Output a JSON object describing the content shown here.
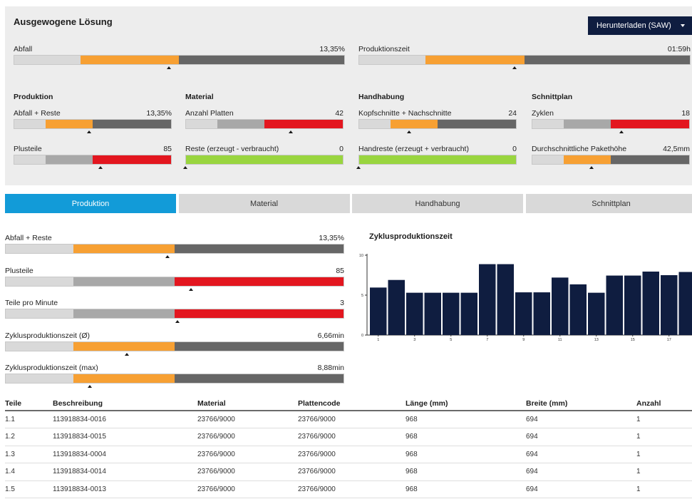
{
  "summary": {
    "title": "Ausgewogene Lösung",
    "download_label": "Herunterladen (SAW)",
    "top_metrics": [
      {
        "label": "Abfall",
        "value": "13,35%",
        "segments": [
          {
            "color": "light",
            "frac": 0.2
          },
          {
            "color": "orange",
            "frac": 0.3
          },
          {
            "color": "dark",
            "frac": 0.5
          }
        ],
        "marker": 0.47
      },
      {
        "label": "Produktionszeit",
        "value": "01:59h",
        "segments": [
          {
            "color": "light",
            "frac": 0.2
          },
          {
            "color": "orange",
            "frac": 0.3
          },
          {
            "color": "dark",
            "frac": 0.5
          }
        ],
        "marker": 0.47
      }
    ],
    "columns": [
      {
        "heading": "Produktion",
        "metrics": [
          {
            "label": "Abfall + Reste",
            "value": "13,35%",
            "segments": [
              {
                "color": "light",
                "frac": 0.2
              },
              {
                "color": "orange",
                "frac": 0.3
              },
              {
                "color": "dark",
                "frac": 0.5
              }
            ],
            "marker": 0.48
          },
          {
            "label": "Plusteile",
            "value": "85",
            "segments": [
              {
                "color": "light",
                "frac": 0.2
              },
              {
                "color": "gray",
                "frac": 0.3
              },
              {
                "color": "red",
                "frac": 0.5
              }
            ],
            "marker": 0.55
          }
        ]
      },
      {
        "heading": "Material",
        "metrics": [
          {
            "label": "Anzahl Platten",
            "value": "42",
            "segments": [
              {
                "color": "light",
                "frac": 0.2
              },
              {
                "color": "gray",
                "frac": 0.3
              },
              {
                "color": "red",
                "frac": 0.5
              }
            ],
            "marker": 0.67
          },
          {
            "label": "Reste (erzeugt - verbraucht)",
            "value": "0",
            "segments": [
              {
                "color": "green",
                "frac": 1.0
              }
            ],
            "marker": 0.0
          }
        ]
      },
      {
        "heading": "Handhabung",
        "metrics": [
          {
            "label": "Kopfschnitte + Nachschnitte",
            "value": "24",
            "segments": [
              {
                "color": "light",
                "frac": 0.2
              },
              {
                "color": "orange",
                "frac": 0.3
              },
              {
                "color": "dark",
                "frac": 0.5
              }
            ],
            "marker": 0.32
          },
          {
            "label": "Handreste (erzeugt + verbraucht)",
            "value": "0",
            "segments": [
              {
                "color": "green",
                "frac": 1.0
              }
            ],
            "marker": 0.0
          }
        ]
      },
      {
        "heading": "Schnittplan",
        "metrics": [
          {
            "label": "Zyklen",
            "value": "18",
            "segments": [
              {
                "color": "light",
                "frac": 0.2
              },
              {
                "color": "gray",
                "frac": 0.3
              },
              {
                "color": "red",
                "frac": 0.5
              }
            ],
            "marker": 0.57
          },
          {
            "label": "Durchschnittliche Pakethöhe",
            "value": "42,5mm",
            "segments": [
              {
                "color": "light",
                "frac": 0.2
              },
              {
                "color": "orange",
                "frac": 0.3
              },
              {
                "color": "dark",
                "frac": 0.5
              }
            ],
            "marker": 0.38
          }
        ]
      }
    ]
  },
  "tabs": [
    {
      "label": "Produktion",
      "active": true
    },
    {
      "label": "Material",
      "active": false
    },
    {
      "label": "Handhabung",
      "active": false
    },
    {
      "label": "Schnittplan",
      "active": false
    }
  ],
  "production_metrics": [
    {
      "label": "Abfall + Reste",
      "value": "13,35%",
      "segments": [
        {
          "color": "light",
          "frac": 0.2
        },
        {
          "color": "orange",
          "frac": 0.3
        },
        {
          "color": "dark",
          "frac": 0.5
        }
      ],
      "marker": 0.48
    },
    {
      "label": "Plusteile",
      "value": "85",
      "segments": [
        {
          "color": "light",
          "frac": 0.2
        },
        {
          "color": "gray",
          "frac": 0.3
        },
        {
          "color": "red",
          "frac": 0.5
        }
      ],
      "marker": 0.55
    },
    {
      "label": "Teile pro Minute",
      "value": "3",
      "segments": [
        {
          "color": "light",
          "frac": 0.2
        },
        {
          "color": "gray",
          "frac": 0.3
        },
        {
          "color": "red",
          "frac": 0.5
        }
      ],
      "marker": 0.51
    },
    {
      "label": "Zyklusproduktionszeit (Ø)",
      "value": "6,66min",
      "segments": [
        {
          "color": "light",
          "frac": 0.2
        },
        {
          "color": "orange",
          "frac": 0.3
        },
        {
          "color": "dark",
          "frac": 0.5
        }
      ],
      "marker": 0.36
    },
    {
      "label": "Zyklusproduktionszeit (max)",
      "value": "8,88min",
      "segments": [
        {
          "color": "light",
          "frac": 0.2
        },
        {
          "color": "orange",
          "frac": 0.3
        },
        {
          "color": "dark",
          "frac": 0.5
        }
      ],
      "marker": 0.25
    }
  ],
  "chart_data": {
    "type": "bar",
    "title": "Zyklusproduktionszeit",
    "x": [
      1,
      2,
      3,
      4,
      5,
      6,
      7,
      8,
      9,
      10,
      11,
      12,
      13,
      14,
      15,
      16,
      17,
      18
    ],
    "x_tick_labels": [
      "1",
      "3",
      "5",
      "7",
      "9",
      "11",
      "13",
      "15",
      "17"
    ],
    "values": [
      5.95,
      6.9,
      5.3,
      5.3,
      5.3,
      5.3,
      8.88,
      8.88,
      5.35,
      5.35,
      7.2,
      6.35,
      5.3,
      7.45,
      7.45,
      7.95,
      7.5,
      7.9
    ],
    "y_ticks": [
      "0",
      "5",
      "10"
    ],
    "ylim": [
      0,
      10
    ],
    "bar_color": "#0f1d40",
    "grid": false
  },
  "parts_table": {
    "columns": [
      "Teile",
      "Beschreibung",
      "Material",
      "Plattencode",
      "Länge (mm)",
      "Breite (mm)",
      "Anzahl"
    ],
    "rows": [
      [
        "1.1",
        "113918834-0016",
        "23766/9000",
        "23766/9000",
        "968",
        "694",
        "1"
      ],
      [
        "1.2",
        "113918834-0015",
        "23766/9000",
        "23766/9000",
        "968",
        "694",
        "1"
      ],
      [
        "1.3",
        "113918834-0004",
        "23766/9000",
        "23766/9000",
        "968",
        "694",
        "1"
      ],
      [
        "1.4",
        "113918834-0014",
        "23766/9000",
        "23766/9000",
        "968",
        "694",
        "1"
      ],
      [
        "1.5",
        "113918834-0013",
        "23766/9000",
        "23766/9000",
        "968",
        "694",
        "1"
      ]
    ]
  }
}
